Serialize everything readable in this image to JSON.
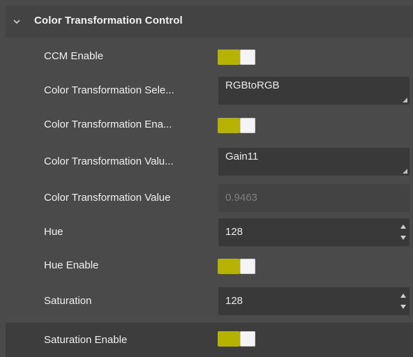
{
  "section": {
    "title": "Color Transformation Control",
    "expanded": true
  },
  "rows": {
    "ccm_enable": {
      "label": "CCM Enable",
      "enabled": true
    },
    "ct_selector": {
      "label": "Color Transformation Sele...",
      "value": "RGBtoRGB"
    },
    "ct_enable": {
      "label": "Color Transformation Ena...",
      "enabled": true
    },
    "ct_value_selector": {
      "label": "Color Transformation Valu...",
      "value": "Gain11"
    },
    "ct_value": {
      "label": "Color Transformation Value",
      "value": "0.9463"
    },
    "hue": {
      "label": "Hue",
      "value": "128"
    },
    "hue_enable": {
      "label": "Hue Enable",
      "enabled": true
    },
    "saturation": {
      "label": "Saturation",
      "value": "128"
    },
    "saturation_enable": {
      "label": "Saturation Enable",
      "enabled": true
    }
  },
  "colors": {
    "panel_bg": "#4a4a4a",
    "header_bg": "#434343",
    "field_bg": "#393939",
    "toggle_on": "#b5b300",
    "knob": "#f4f4f4",
    "selected_row_bg": "#3d3d3d"
  },
  "icons": {
    "collapse": "chevron-down-icon",
    "dropdown": "resize-grip-icon",
    "spinner": "spinner-arrows-icon"
  }
}
